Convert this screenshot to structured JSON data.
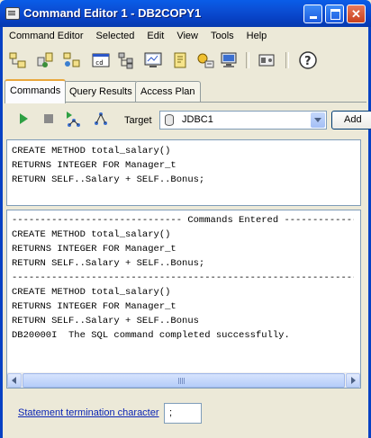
{
  "window": {
    "title": "Command Editor 1 - DB2COPY1"
  },
  "menu": [
    "Command Editor",
    "Selected",
    "Edit",
    "View",
    "Tools",
    "Help"
  ],
  "toolbar": {
    "icons": [
      "add-db-icon",
      "connect-icon",
      "sql-assist-icon",
      "command-window-icon",
      "object-tree-icon",
      "control-center-icon",
      "journal-icon",
      "license-icon",
      "task-center-icon",
      "settings-icon",
      "help-icon"
    ]
  },
  "tabs": [
    "Commands",
    "Query Results",
    "Access Plan"
  ],
  "command_bar": {
    "target_label": "Target",
    "target_value": "JDBC1",
    "add_label": "Add"
  },
  "editor": {
    "lines": [
      "CREATE METHOD total_salary()",
      "RETURNS INTEGER FOR Manager_t",
      "RETURN SELF..Salary + SELF..Bonus;"
    ]
  },
  "results": {
    "lines": [
      "------------------------------ Commands Entered ------------------------------",
      "CREATE METHOD total_salary()",
      "RETURNS INTEGER FOR Manager_t",
      "RETURN SELF..Salary + SELF..Bonus;",
      "------------------------------------------------------------------------------",
      "CREATE METHOD total_salary()",
      "RETURNS INTEGER FOR Manager_t",
      "RETURN SELF..Salary + SELF..Bonus",
      "DB20000I  The SQL command completed successfully."
    ]
  },
  "footer": {
    "termination_label": "Statement termination character",
    "termination_value": ";"
  }
}
